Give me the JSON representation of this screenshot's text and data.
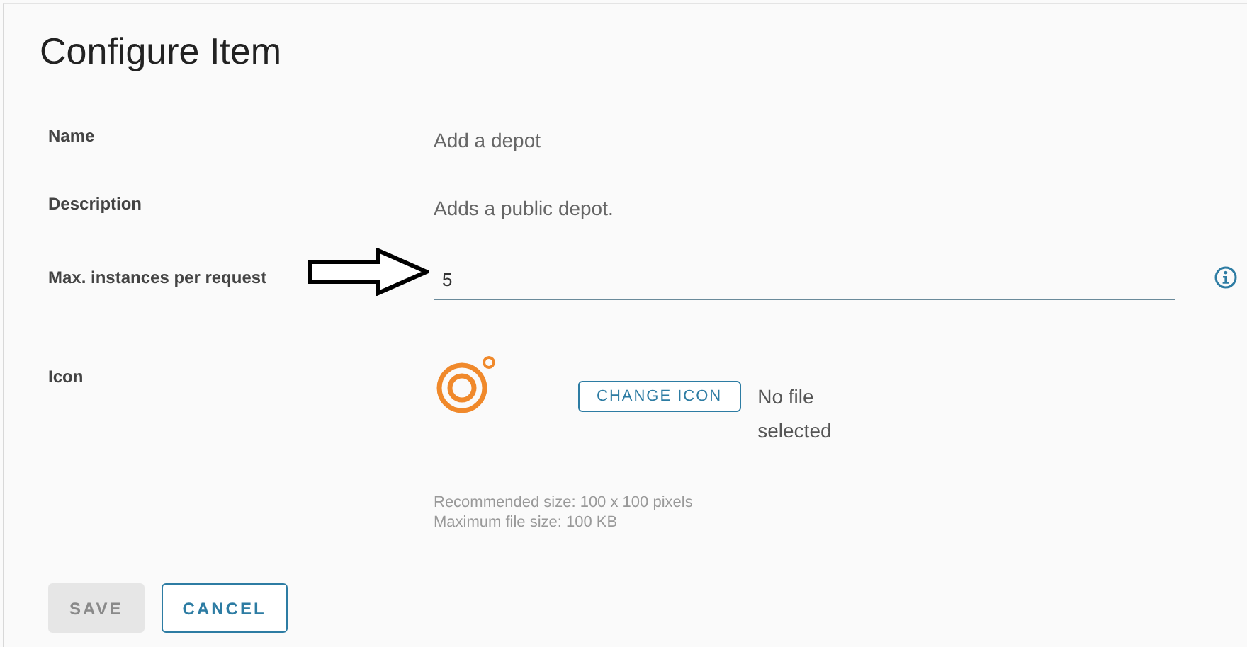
{
  "dialog": {
    "title": "Configure Item"
  },
  "fields": [
    {
      "kind": "text",
      "label": "Name",
      "value": "Add a depot"
    },
    {
      "kind": "text",
      "label": "Description",
      "value": "Adds a public depot."
    },
    {
      "kind": "input",
      "label": "Max. instances per request",
      "value": "5"
    }
  ],
  "icon_field": {
    "label": "Icon",
    "button": "CHANGE ICON",
    "file_status": "No file selected",
    "hints": [
      "Recommended size: 100 x 100 pixels",
      "Maximum file size: 100 KB"
    ]
  },
  "buttons": [
    {
      "label": "SAVE",
      "disabled": true
    },
    {
      "label": "CANCEL",
      "disabled": false
    }
  ]
}
